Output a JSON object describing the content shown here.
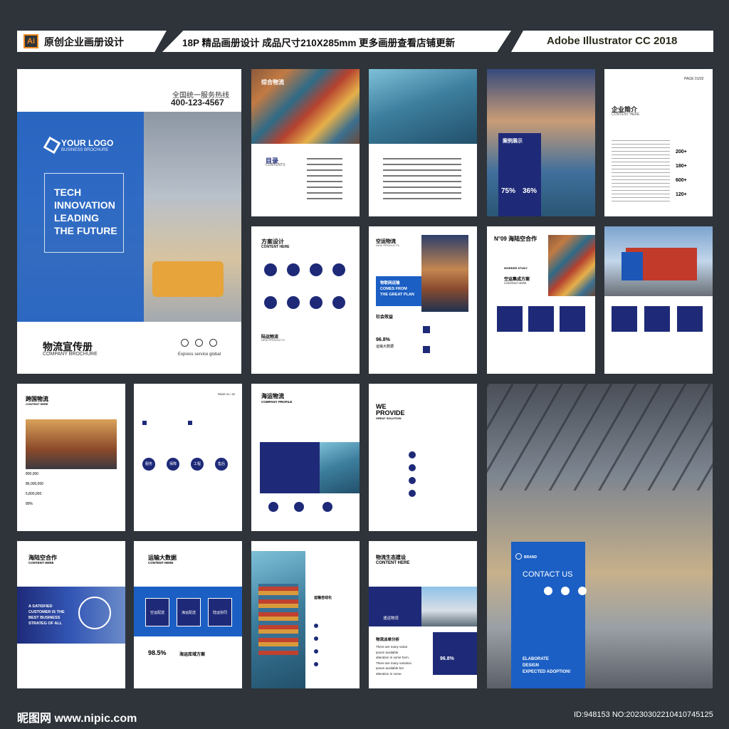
{
  "header": {
    "ai_badge": "Ai",
    "left_title": "原创企业画册设计",
    "mid_title": "18P 精品画册设计  成品尺寸210X285mm  更多画册查看店铺更新",
    "right_title": "Adobe Illustrator CC 2018"
  },
  "cover": {
    "hotline_label": "全国统一服务热线",
    "hotline_number": "400-123-4567",
    "logo_text": "YOUR LOGO",
    "logo_sub": "BUSINESS BROCHURE",
    "headline": [
      "TECH",
      "INNOVATION",
      "LEADING",
      "THE FUTURE"
    ],
    "title_cn": "物流宣传册",
    "title_en": "COMPANY BROCHURE",
    "service_text": "Express service global"
  },
  "pages": {
    "p2_title": "综合物流",
    "p2_toc": "目录",
    "p2_toc_en": "CONTENTS",
    "p4_case_title": "案例展示",
    "p4_stat1": "75%",
    "p4_stat2": "36%",
    "p5_title": "企业简介",
    "p5_sub": "CONTENT HERE",
    "p5_page": "PAGE 01/02",
    "p5_stats": [
      "200+",
      "180+",
      "600+",
      "120+"
    ],
    "p6_title": "方案设计",
    "p6_sub": "CONTENT HERE",
    "p6_block_title": "陆运物流",
    "p6_block_sub": "NEW PRODUCTS",
    "p7_title": "空运物流",
    "p7_sub": "NEW PRODUCTS",
    "p7_banner": [
      "物联网运输",
      "COMES FROM",
      "THE GREAT PLAN"
    ],
    "p7_section": "社会效益",
    "p7_stat": "96.8%",
    "p7_stat_label": "运输大数据",
    "p8_num": "N°09",
    "p8_title": "海陆空合作",
    "p8_sub1": "WORKER STUDY",
    "p8_sub2": "空运集成方案",
    "p8_sub3": "CONTENT HERE",
    "p10_title": "跨国物流",
    "p10_sub": "CONTENT HERE",
    "p10_numbers": [
      "800,000",
      "86,000,000",
      "5,800,000",
      "89%"
    ],
    "p11_page": "PAGE 01 / 02",
    "p11_labels": [
      "服务",
      "保障",
      "工程",
      "售后"
    ],
    "p12_title": "海运物流",
    "p12_sub": "COMPANY PROFILE",
    "p13_title": [
      "WE",
      "PROVIDE"
    ],
    "p13_sub": "GREAT SOLUTION",
    "p15_title": "海陆空合作",
    "p15_sub": "CONTENT HERE",
    "p15_banner": [
      "A SATISFIED",
      "CUSTOMER IS THE",
      "BEST BUSINESS",
      "STRATEG OF ALL"
    ],
    "p16_title": "运输大数据",
    "p16_sub": "CONTENT HERE",
    "p16_boxes": [
      "空运配送",
      "海运配送",
      "陆运协同"
    ],
    "p16_stat": "98.5%",
    "p16_stat_label": "海运库域方案",
    "p17_label": "运输自动化",
    "p18_title": "物流生态建设",
    "p18_sub": "CONTENT HERE",
    "p18_box": "速运物流",
    "p18_analysis": "物流派单分析",
    "p18_stat": "96.8%",
    "p18_bullets": [
      "There are many variat",
      "Ipsum available",
      "alteration in some form.",
      "There are many variation",
      "Ipsum available but",
      "alteration in some."
    ],
    "p19_brand": "BRAND",
    "p19_contact": "CONTACT US",
    "p19_tagline": [
      "ELABORATE",
      "DESIGN",
      "EXPECTED ADOPTION!"
    ]
  },
  "footer": {
    "site": "昵图网 www.nipic.com",
    "id": "ID:948153 NO:20230302210410745125"
  }
}
